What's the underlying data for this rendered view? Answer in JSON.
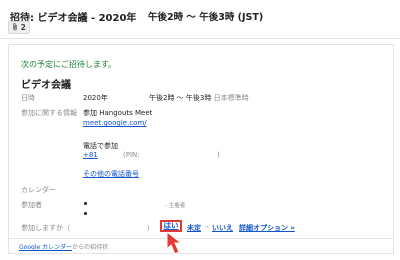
{
  "header": {
    "subject": "招待: ビデオ会議 - 2020年",
    "time": "午後2時 〜 午後3時 (JST)",
    "attachment_count": "2"
  },
  "card": {
    "invite_text": "次の予定にご招待します。",
    "event_title": "ビデオ会議",
    "when": {
      "label": "日時",
      "date": "2020年",
      "time": "午後2時 〜 午後3時",
      "timezone": "日本標準時"
    },
    "joining": {
      "label": "参加に関する情報",
      "hangouts": "参加 Hangouts Meet",
      "meet_link": "meet.google.com/",
      "phone_heading": "電話で参加",
      "phone_number": "+81",
      "pin": "(PIN:",
      "pin_close": ")",
      "more_numbers": "その他の電話番号"
    },
    "calendar": {
      "label": "カレンダー"
    },
    "attendees": {
      "label": "参加者",
      "organizer_tag": "- 主催者"
    },
    "rsvp": {
      "label": "参加しますか（",
      "close_paren": "）",
      "yes": "はい",
      "maybe": "未定",
      "separator": "-",
      "no": "いいえ",
      "more_options": "詳細オプション »"
    },
    "footer": {
      "calendar_link": "Google カレンダー",
      "suffix": "からの招待状"
    }
  },
  "colors": {
    "link": "#1155cc",
    "invite_green": "#188038",
    "highlight_red": "#e53935"
  },
  "icons": {
    "attachment": "paperclip-icon",
    "pointer": "cursor-arrow-icon"
  }
}
